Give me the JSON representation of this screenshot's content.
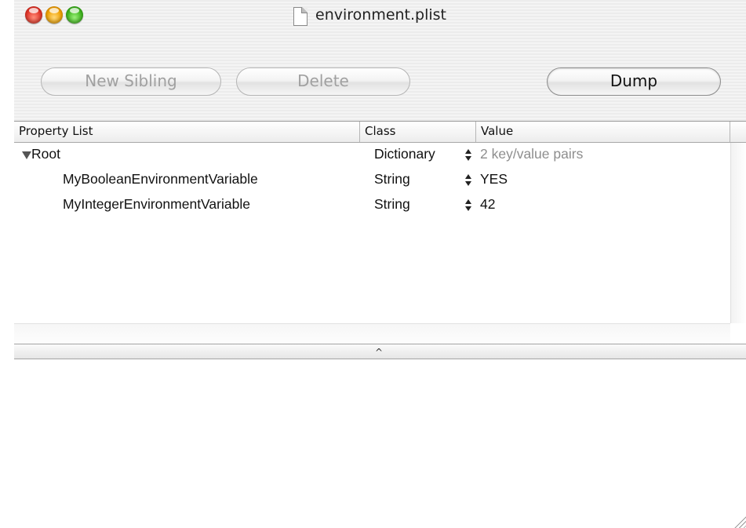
{
  "window": {
    "title": "environment.plist"
  },
  "toolbar": {
    "new_sibling_label": "New Sibling",
    "delete_label": "Delete",
    "dump_label": "Dump"
  },
  "outline": {
    "columns": [
      "Property List",
      "Class",
      "Value"
    ],
    "rows": [
      {
        "key": "Root",
        "class": "Dictionary",
        "value": "2 key/value pairs",
        "expanded": true,
        "level": 0
      },
      {
        "key": "MyBooleanEnvironmentVariable",
        "class": "String",
        "value": "YES",
        "level": 1
      },
      {
        "key": "MyIntegerEnvironmentVariable",
        "class": "String",
        "value": "42",
        "level": 1
      }
    ]
  },
  "text_area": {
    "content": ""
  },
  "colors": {
    "muted_text": "#8e8e8e",
    "close": "#e2372b",
    "minimize": "#f0a100",
    "zoom": "#3fb51e"
  }
}
